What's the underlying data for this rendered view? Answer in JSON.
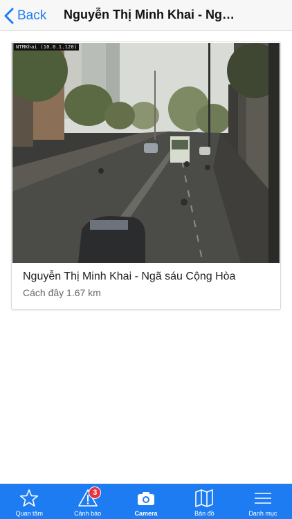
{
  "navbar": {
    "back_label": "Back",
    "title": "Nguyễn Thị Minh Khai - Ngã sáu Cộng Hòa",
    "accent_color": "#1e7cf2"
  },
  "camera_card": {
    "overlay_text": "NTMKhai (10.0.1.120)",
    "title": "Nguyễn Thị Minh Khai - Ngã sáu Cộng Hòa",
    "distance": "Cách đây 1.67 km"
  },
  "tabbar": {
    "background_color": "#1e7cf2",
    "tabs": [
      {
        "label": "Quan tâm",
        "icon": "star-icon"
      },
      {
        "label": "Cảnh báo",
        "icon": "warning-icon",
        "badge": "3"
      },
      {
        "label": "Camera",
        "icon": "camera-icon",
        "active": true
      },
      {
        "label": "Bản đồ",
        "icon": "map-icon"
      },
      {
        "label": "Danh mục",
        "icon": "menu-icon"
      }
    ]
  }
}
